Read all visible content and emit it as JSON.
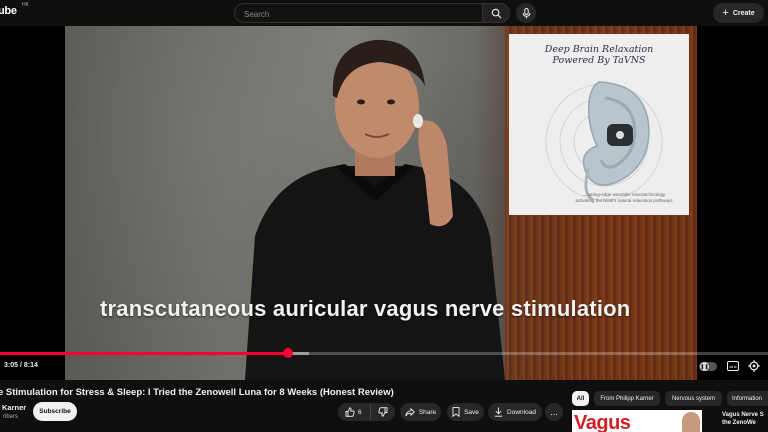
{
  "header": {
    "logo": "ube",
    "region": "HK",
    "search_placeholder": "Search",
    "create_label": "Create"
  },
  "player": {
    "promo_title_line1": "Deep Brain Relaxation",
    "promo_title_line2": "Powered By TaVNS",
    "promo_caption_line1": "...cutting-edge wearable neurotechnology",
    "promo_caption_line2": "activating the brain's natural relaxation pathways",
    "caption": "transcutaneous auricular vagus nerve stimulation",
    "current_time": "3:05",
    "duration": "8:14",
    "time_display": "3:05 / 8:14",
    "played_fraction": 0.3745,
    "buffered_fraction": 0.402,
    "colors": {
      "progress": "#ff0033",
      "background": "#0f0f0f"
    }
  },
  "video": {
    "title": "e Stimulation for Stress & Sleep: I Tried the Zenowell Luna for 8 Weeks (Honest Review)",
    "channel_name": "Karner",
    "channel_subs": "ribers",
    "subscribe_label": "Subscribe",
    "like_count": "6",
    "share_label": "Share",
    "save_label": "Save",
    "download_label": "Download",
    "more_label": "..."
  },
  "sidebar": {
    "chips": [
      "All",
      "From Philipp Karner",
      "Nervous system",
      "Information"
    ],
    "active_chip": "All",
    "recommendation": {
      "thumb_text": "Vagus",
      "title_line1": "Vagus Nerve S",
      "title_line2": "the ZenoWe"
    }
  }
}
